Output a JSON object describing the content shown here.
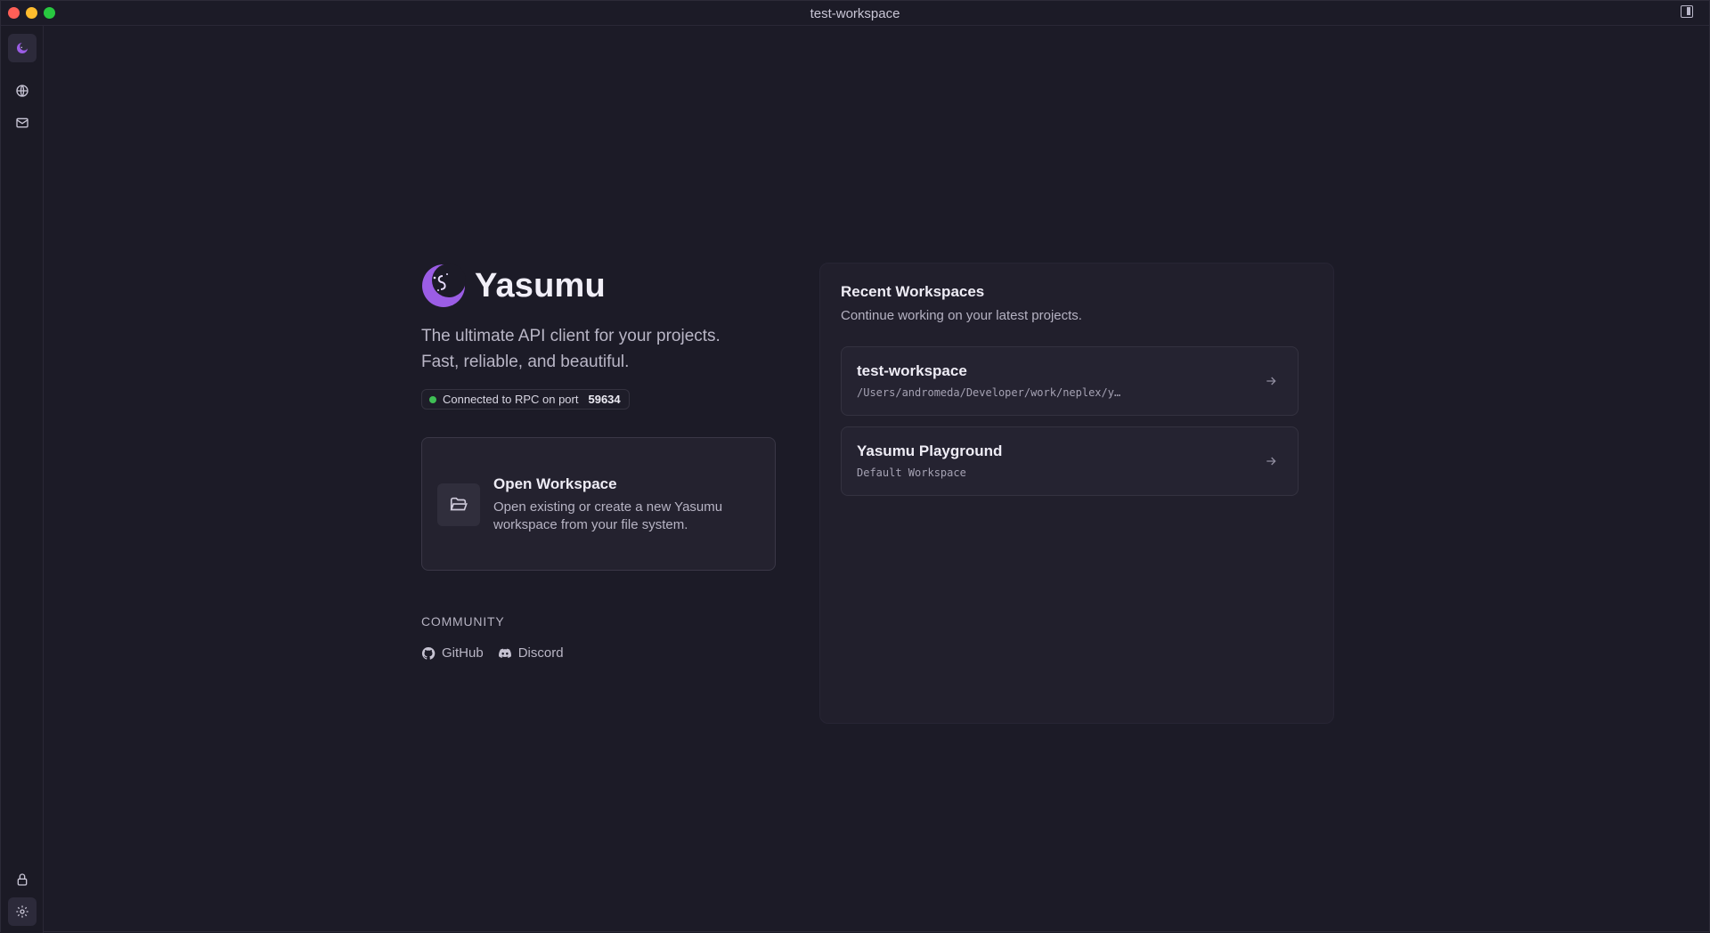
{
  "window": {
    "title": "test-workspace"
  },
  "rail": {
    "items": [
      {
        "name": "yasumu-logo"
      },
      {
        "name": "globe"
      },
      {
        "name": "mail"
      }
    ],
    "bottom": [
      {
        "name": "lock"
      },
      {
        "name": "settings"
      }
    ]
  },
  "hero": {
    "brand": "Yasumu",
    "tagline_line1": "The ultimate API client for your projects.",
    "tagline_line2": "Fast, reliable, and beautiful.",
    "rpc_status": "Connected to RPC on port",
    "rpc_port": "59634",
    "rpc_color": "#3fbf55"
  },
  "open_workspace": {
    "title": "Open Workspace",
    "description": "Open existing or create a new Yasumu workspace from your file system."
  },
  "community": {
    "label": "COMMUNITY",
    "links": [
      {
        "label": "GitHub",
        "icon": "github-icon"
      },
      {
        "label": "Discord",
        "icon": "discord-icon"
      }
    ]
  },
  "recent": {
    "title": "Recent Workspaces",
    "subtitle": "Continue working on your latest projects.",
    "workspaces": [
      {
        "name": "test-workspace",
        "path": "/Users/andromeda/Developer/work/neplex/y…"
      },
      {
        "name": "Yasumu Playground",
        "path": "Default Workspace"
      }
    ]
  },
  "colors": {
    "accent": "#9b5de5",
    "background": "#1c1b27",
    "panel": "#211f2c"
  }
}
